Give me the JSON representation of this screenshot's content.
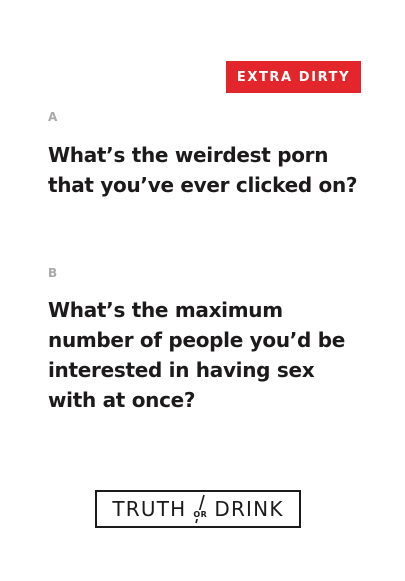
{
  "badge": {
    "label": "EXTRA DIRTY",
    "color": "#e3262b"
  },
  "options": [
    {
      "letter": "A",
      "question": "What’s the weirdest porn that you’ve ever clicked on?"
    },
    {
      "letter": "B",
      "question": "What’s the maximum number of people you’d be interested in having sex with at once?"
    }
  ],
  "logo": {
    "word_left": "TRUTH",
    "word_middle": "OR",
    "word_right": "DRINK"
  },
  "colors": {
    "text": "#1c1a1b",
    "label": "#a9a9a9",
    "background": "#ffffff"
  }
}
